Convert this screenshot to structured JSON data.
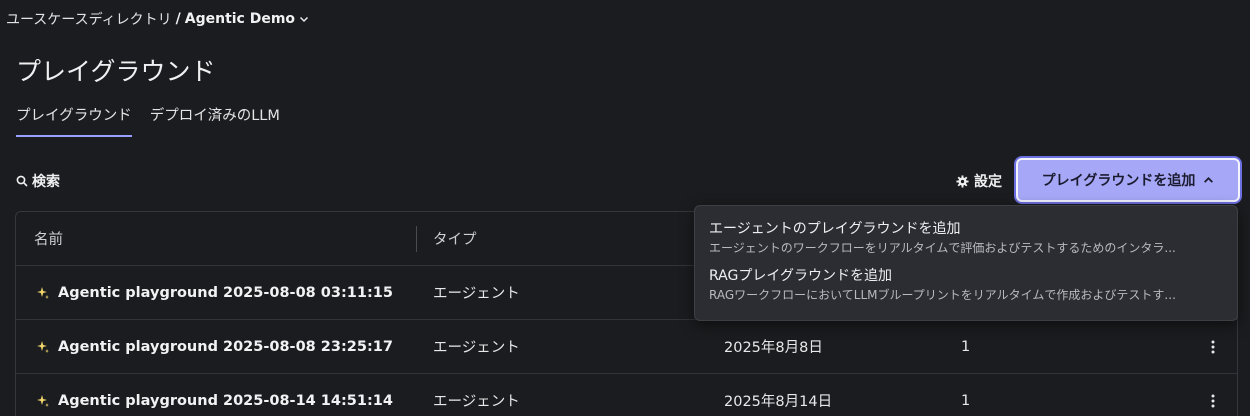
{
  "breadcrumb": {
    "parent": "ユースケースディレクトリ",
    "separator": "/",
    "current": "Agentic Demo"
  },
  "page_title": "プレイグラウンド",
  "tabs": [
    {
      "label": "プレイグラウンド",
      "active": true
    },
    {
      "label": "デプロイ済みのLLM",
      "active": false
    }
  ],
  "toolbar": {
    "search_label": "検索",
    "settings_label": "設定",
    "add_label": "プレイグラウンドを追加"
  },
  "table": {
    "columns": [
      "名前",
      "タイプ"
    ],
    "rows": [
      {
        "name": "Agentic playground 2025-08-08 03:11:15",
        "type": "エージェント",
        "date": "",
        "count": ""
      },
      {
        "name": "Agentic playground 2025-08-08 23:25:17",
        "type": "エージェント",
        "date": "2025年8月8日",
        "count": "1"
      },
      {
        "name": "Agentic playground 2025-08-14 14:51:14",
        "type": "エージェント",
        "date": "2025年8月14日",
        "count": "1"
      }
    ]
  },
  "dropdown": {
    "items": [
      {
        "title": "エージェントのプレイグラウンドを追加",
        "description": "エージェントのワークフローをリアルタイムで評価およびテストするためのインタラ..."
      },
      {
        "title": "RAGプレイグラウンドを追加",
        "description": "RAGワークフローにおいてLLMブループリントをリアルタイムで作成およびテストす..."
      }
    ]
  },
  "colors": {
    "background": "#1b1c1f",
    "accent": "#a6a8f7",
    "menu_bg": "#2c2d32"
  }
}
